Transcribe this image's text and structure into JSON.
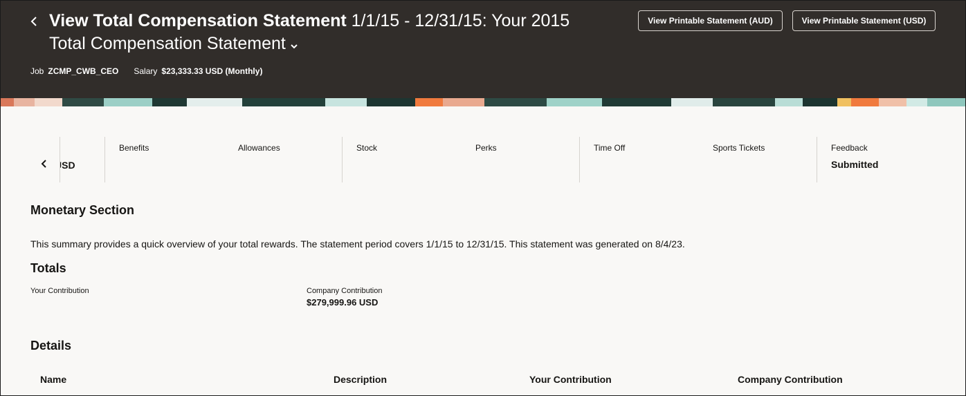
{
  "header": {
    "title_bold": "View Total Compensation Statement",
    "title_rest": "1/1/15 - 12/31/15: Your 2015 Total Compensation Statement",
    "job_label": "Job",
    "job_value": "ZCMP_CWB_CEO",
    "salary_label": "Salary",
    "salary_value": "$23,333.33 USD (Monthly)",
    "btn_aud": "View Printable Statement (AUD)",
    "btn_usd": "View Printable Statement (USD)",
    "colors": {
      "background": "#312d2a",
      "text": "#ffffff"
    }
  },
  "tabs": {
    "partial_value": "USD",
    "items": [
      {
        "label": "Benefits"
      },
      {
        "label": "Allowances"
      },
      {
        "label": "Stock"
      },
      {
        "label": "Perks"
      },
      {
        "label": "Time Off"
      },
      {
        "label": "Sports Tickets"
      },
      {
        "label": "Feedback",
        "value": "Submitted"
      }
    ]
  },
  "monetary": {
    "heading": "Monetary Section",
    "summary": "This summary provides a quick overview of your total rewards. The statement period covers 1/1/15 to 12/31/15. This statement was generated on 8/4/23."
  },
  "totals": {
    "heading": "Totals",
    "your_label": "Your Contribution",
    "company_label": "Company Contribution",
    "company_value": "$279,999.96 USD"
  },
  "details": {
    "heading": "Details",
    "columns": [
      "Name",
      "Description",
      "Your Contribution",
      "Company Contribution"
    ]
  },
  "icons": {
    "back": "chevron-left-icon",
    "title_menu": "chevron-down-icon",
    "tabs_back": "chevron-left-icon"
  }
}
